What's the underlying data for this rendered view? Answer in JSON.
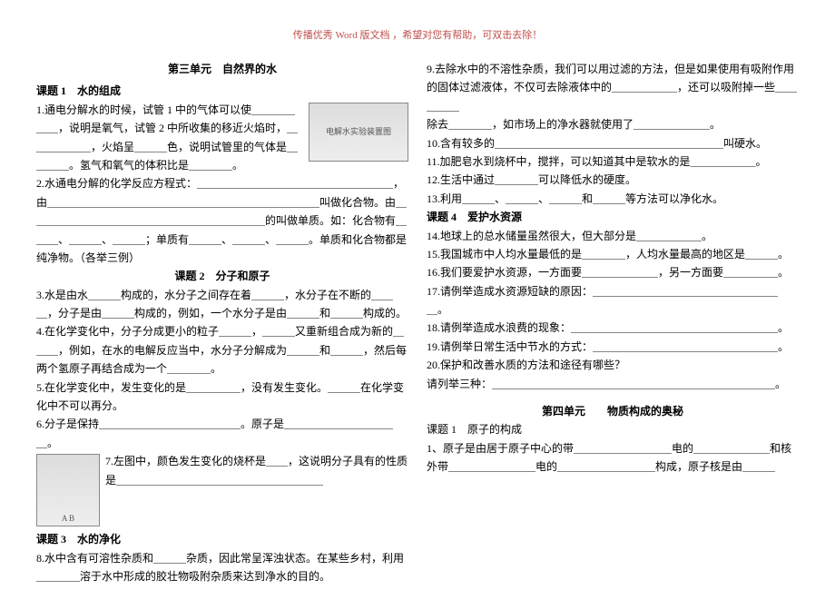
{
  "header_note": "传播优秀 Word 版文档 ，希望对您有帮助，可双击去除！",
  "left": {
    "unit_title": "第三单元　自然界的水",
    "topic1": "课题 1　水的组成",
    "p1": "1.通电分解水的时候，试管 1 中的气体可以使＿＿＿＿＿＿，说明是氧气，试管 2 中所收集的移近火焰时，＿＿＿＿＿＿，火焰呈＿＿＿色，说明试管里的气体是＿＿＿＿。氢气和氧气的体积比是＿＿＿＿。",
    "p2": "2.水通电分解的化学反应方程式：＿＿＿＿＿＿＿＿＿＿＿＿＿＿＿＿＿＿，由＿＿＿＿＿＿＿＿＿＿＿＿＿＿＿＿＿＿＿＿＿＿＿＿＿叫做化合物。由＿＿＿＿＿＿＿＿＿＿＿＿＿＿＿＿＿＿＿＿＿＿的叫做单质。如：化合物有＿＿＿、＿＿＿、＿＿＿；单质有＿＿＿、＿＿＿、＿＿＿。单质和化合物都是纯净物。（各举三例）",
    "topic2": "课题 2　分子和原子",
    "p3": "3.水是由水＿＿＿构成的，水分子之间存在着＿＿＿，水分子在不断的＿＿＿，分子是由＿＿＿构成的，例如，一个水分子是由＿＿＿和＿＿＿构成的。",
    "p4": "4.在化学变化中，分子分成更小的粒子＿＿＿，＿＿＿又重新组合成为新的＿＿＿，例如，在水的电解反应当中，水分子分解成为＿＿＿和＿＿＿，然后每两个氢原子再结合成为一个＿＿＿＿。",
    "p5": "5.在化学变化中，发生变化的是＿＿＿＿＿，没有发生变化。＿＿＿在化学变化中不可以再分。",
    "p6": "6.分子是保持＿＿＿＿＿＿＿＿＿＿＿＿＿。原子是＿＿＿＿＿＿＿＿＿＿＿。",
    "p7": "7.左图中，颜色发生变化的烧杯是＿＿，这说明分子具有的性质是＿＿＿＿＿＿＿＿＿＿＿＿＿＿＿＿＿＿＿",
    "topic3": "课题 3　水的净化",
    "p8": "8.水中含有可溶性杂质和＿＿＿杂质，因此常呈浑浊状态。在某些乡村，利用＿＿＿＿溶于水中形成的胶壮物吸附杂质来达到净水的目的。",
    "img1_alt": "电解水实验装置图",
    "img2_alt": "A  B"
  },
  "right": {
    "p9": "9.去除水中的不溶性杂质，我们可以用过滤的方法，但是如果使用有吸附作用的固体过滤液体，不仅可去除液体中的＿＿＿＿＿＿，还可以吸附掉一些＿＿＿＿＿",
    "p9b": "除去＿＿＿＿，如市场上的净水器就使用了＿＿＿＿＿＿＿。",
    "p10": "10.含有较多的＿＿＿＿＿＿＿＿＿＿＿＿＿＿＿＿＿＿＿＿＿叫硬水。",
    "p11": "11.加肥皂水到烧杯中，搅拌，可以知道其中是软水的是＿＿＿＿＿＿。",
    "p12": "12.生活中通过＿＿＿＿可以降低水的硬度。",
    "p13": "13.利用＿＿＿、＿＿＿、＿＿＿和＿＿＿等方法可以净化水。",
    "topic4": "课题 4　爱护水资源",
    "p14": "14.地球上的总水储量虽然很大，但大部分是＿＿＿＿＿＿。",
    "p15": "15.我国城市中人均水量最低的是＿＿＿＿，人均水量最高的地区是＿＿＿。",
    "p16": "16.我们要爱护水资源，一方面要＿＿＿＿＿＿＿，另一方面要＿＿＿＿＿。",
    "p17": "17.请例举造成水资源短缺的原因：＿＿＿＿＿＿＿＿＿＿＿＿＿＿＿＿＿＿。",
    "p18": "18.请例举造成水浪费的现象：＿＿＿＿＿＿＿＿＿＿＿＿＿＿＿＿＿＿＿。",
    "p19": "19.请例举日常生活中节水的方式：＿＿＿＿＿＿＿＿＿＿＿＿＿＿＿＿＿。",
    "p20": "20.保护和改善水质的方法和途径有哪些？",
    "p20b": "请列举三种：＿＿＿＿＿＿＿＿＿＿＿＿＿＿＿＿＿＿＿＿＿＿＿＿＿＿。",
    "unit4_title": "第四单元　　物质构成的奥秘",
    "unit4_topic1": "课题 1　原子的构成",
    "u4p1": "1、原子是由居于原子中心的带＿＿＿＿＿＿＿＿＿电的＿＿＿＿＿＿＿和核外带＿＿＿＿＿＿＿＿电的＿＿＿＿＿＿＿＿＿构成，原子核是由＿＿＿"
  }
}
